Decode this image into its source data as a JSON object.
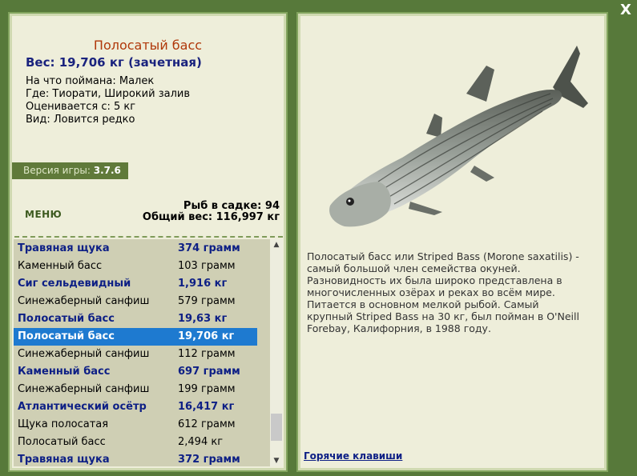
{
  "fish": {
    "name": "Полосатый басс",
    "weight": "Вес: 19,706 кг (зачетная)",
    "caught_with": "На что поймана: Малек",
    "where": "Где: Тиорати, Широкий залив",
    "value": "Оценивается с: 5 кг",
    "rarity": "Вид: Ловится редко"
  },
  "version": {
    "label": "Версия игры:",
    "value": "3.7.6"
  },
  "menu_label": "МЕНЮ",
  "stats": {
    "count": "Рыб в садке: 94",
    "total": "Общий вес: 116,997 кг"
  },
  "catch_list": [
    {
      "name": "Травяная щука",
      "weight": "374 грамм",
      "bold": true
    },
    {
      "name": "Каменный басс",
      "weight": "103 грамм",
      "bold": false
    },
    {
      "name": "Сиг сельдевидный",
      "weight": "1,916 кг",
      "bold": true
    },
    {
      "name": "Синежаберный санфиш",
      "weight": "579 грамм",
      "bold": false
    },
    {
      "name": "Полосатый басс",
      "weight": "19,63 кг",
      "bold": true
    },
    {
      "name": "Полосатый басс",
      "weight": "19,706 кг",
      "bold": true,
      "selected": true
    },
    {
      "name": "Синежаберный санфиш",
      "weight": "112 грамм",
      "bold": false
    },
    {
      "name": "Каменный басс",
      "weight": "697 грамм",
      "bold": true
    },
    {
      "name": "Синежаберный санфиш",
      "weight": "199 грамм",
      "bold": false
    },
    {
      "name": "Атлантический осётр",
      "weight": "16,417 кг",
      "bold": true
    },
    {
      "name": "Щука полосатая",
      "weight": "612 грамм",
      "bold": false
    },
    {
      "name": "Полосатый басс",
      "weight": "2,494 кг",
      "bold": false
    },
    {
      "name": "Травяная щука",
      "weight": "372 грамм",
      "bold": true
    }
  ],
  "description": "Полосатый басс или Striped Bass (Morone saxatilis) - самый большой член семейства окуней. Разновидность их была широко представлена в многочисленных озёрах и реках во всём мире. Питается в основном мелкой рыбой. Самый крупный Striped Bass на 30 кг, был пойман в O'Neill Forebay, Калифорния, в 1988 году.",
  "hotkeys_label": "Горячие клавиши",
  "close_label": "X",
  "colors": {
    "background": "#57793a",
    "panel": "#eeeeda",
    "selection": "#1e7ad0",
    "fish_name": "#b0380a",
    "bold_text": "#0d1f85"
  }
}
